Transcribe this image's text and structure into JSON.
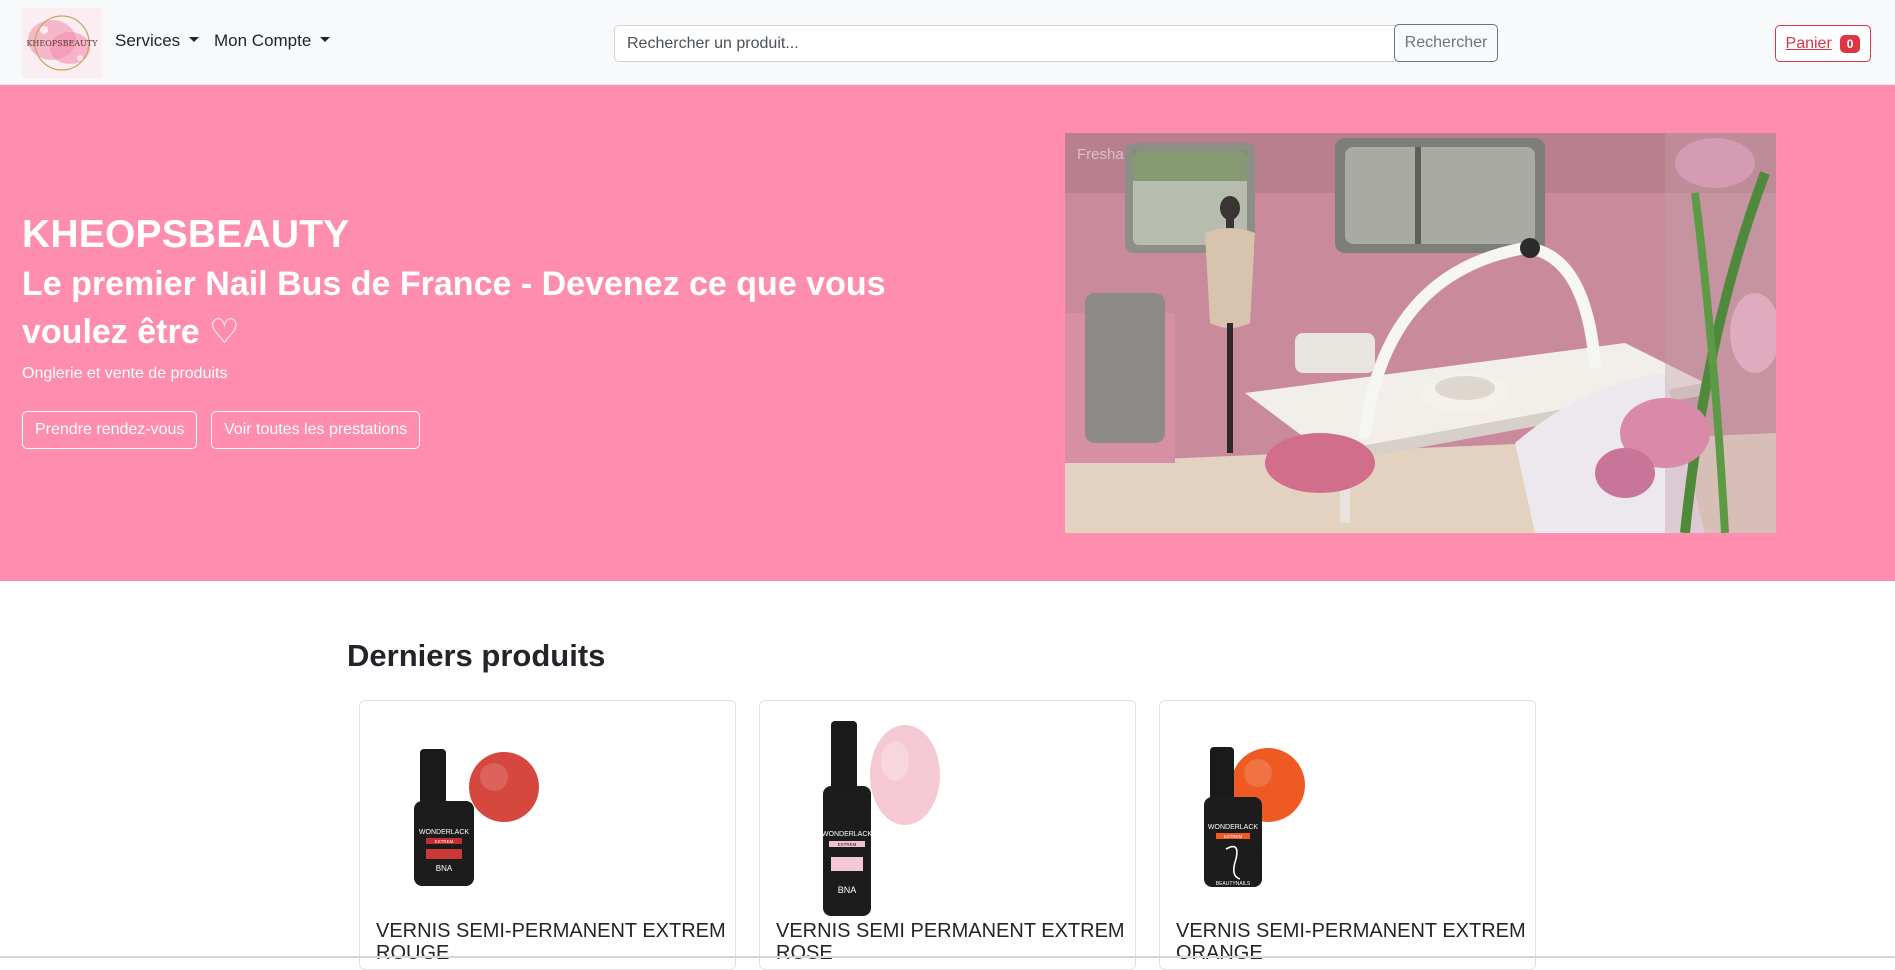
{
  "navbar": {
    "brand_text": "KHEOPSBEAUTY",
    "menu": [
      {
        "label": "Services"
      },
      {
        "label": "Mon Compte"
      }
    ],
    "search": {
      "placeholder": "Rechercher un produit...",
      "button_label": "Rechercher"
    },
    "cart": {
      "label": "Panier",
      "count": "0"
    }
  },
  "hero": {
    "title": "KHEOPSBEAUTY",
    "subtitle": "Le premier Nail Bus de France - Devenez ce que vous voulez être ♡",
    "description": "Onglerie et vente de produits",
    "buttons": [
      {
        "label": "Prendre rendez-vous"
      },
      {
        "label": "Voir toutes les prestations"
      }
    ],
    "image_watermark": "Fresha"
  },
  "products": {
    "section_title": "Derniers produits",
    "items": [
      {
        "title": "VERNIS SEMI-PERMANENT EXTREM ROUGE",
        "swatch_color": "#d6473f",
        "bottle_brand": "WONDERLACK",
        "bottle_line": "EXTREM",
        "bottle_mark": "BNA"
      },
      {
        "title": "VERNIS SEMI PERMANENT EXTREM ROSE",
        "swatch_color": "#f4c9d4",
        "bottle_brand": "WONDERLACK",
        "bottle_line": "EXTREM",
        "bottle_mark": "BNA"
      },
      {
        "title": "VERNIS SEMI-PERMANENT EXTREM ORANGE",
        "swatch_color": "#ef5a22",
        "bottle_brand": "WONDERLACK",
        "bottle_line": "EXTREM",
        "bottle_mark": "BEAUTYNAILS"
      }
    ]
  },
  "colors": {
    "hero_bg": "#ff8daf",
    "navbar_bg": "#f8f9fa",
    "cart_accent": "#dc3545"
  }
}
